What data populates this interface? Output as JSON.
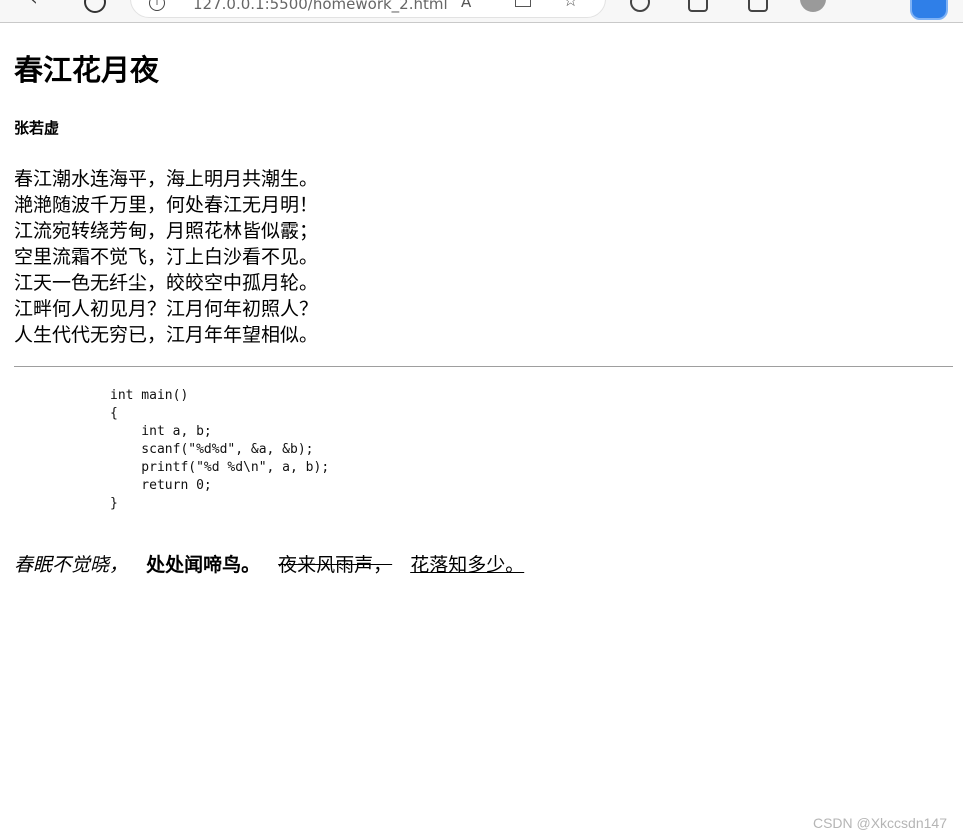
{
  "browser": {
    "url": "127.0.0.1:5500/homework_2.html",
    "icons": [
      "back-arrow-icon",
      "refresh-icon",
      "site-info-icon",
      "read-aloud-icon",
      "split-screen-icon",
      "favorite-star-icon",
      "collections-icon",
      "extensions-icon",
      "tab-actions-icon",
      "profile-avatar-icon",
      "copilot-icon"
    ],
    "read_aloud_glyph": "A",
    "star_glyph": "☆",
    "info_glyph": "i"
  },
  "page": {
    "title": "春江花月夜",
    "author": "张若虚",
    "poem_lines": [
      "春江潮水连海平，海上明月共潮生。",
      "滟滟随波千万里，何处春江无月明！",
      "江流宛转绕芳甸，月照花林皆似霰；",
      "空里流霜不觉飞，汀上白沙看不见。",
      "江天一色无纤尘，皎皎空中孤月轮。",
      "江畔何人初见月？江月何年初照人？",
      "人生代代无穷已，江月年年望相似。"
    ],
    "code": "int main()\n{\n    int a, b;\n    scanf(\"%d%d\", &a, &b);\n    printf(\"%d %d\\n\", a, b);\n    return 0;\n}",
    "styled_line": {
      "italic": "春眠不觉晓，",
      "bold": "处处闻啼鸟。",
      "strike": "夜来风雨声，",
      "underline": "花落知多少。"
    },
    "watermark": "CSDN @Xkccsdn147"
  },
  "colors": {
    "copilot_blue": "#2f7fe8",
    "hr_gray": "#9e9e9e",
    "watermark_gray": "#b5b5b5"
  }
}
